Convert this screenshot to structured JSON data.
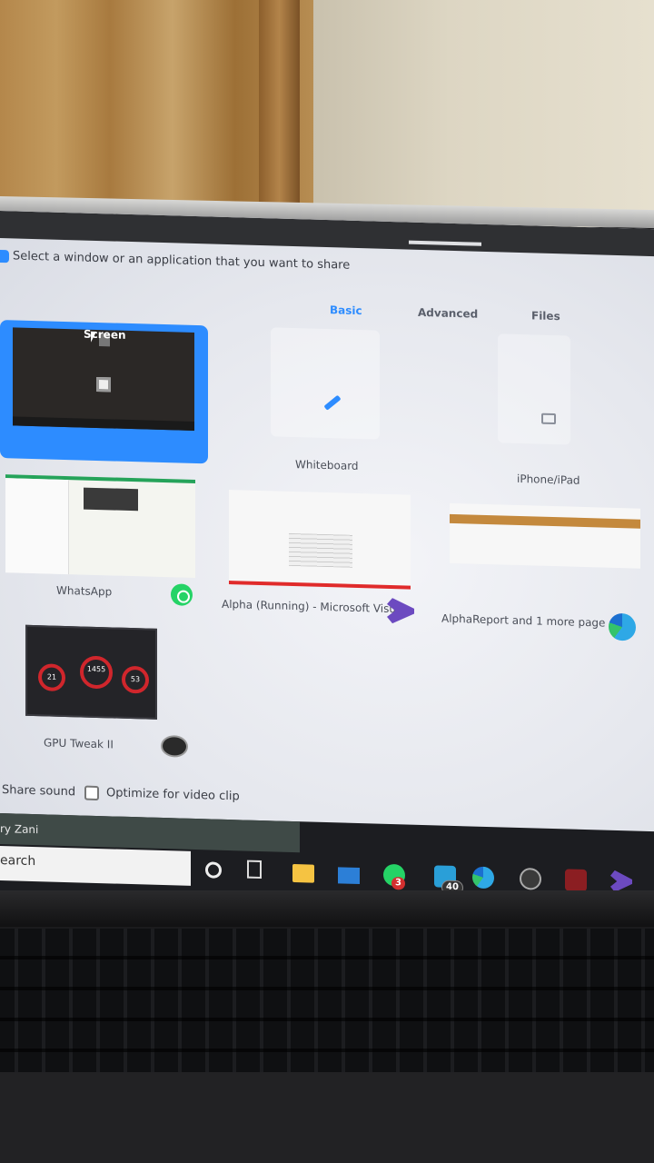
{
  "dialog": {
    "prompt": "Select a window or an application that you want to share"
  },
  "tabs": [
    {
      "label": "Basic",
      "active": true
    },
    {
      "label": "Advanced",
      "active": false
    },
    {
      "label": "Files",
      "active": false
    }
  ],
  "share_options": {
    "screen": "Screen",
    "whiteboard": "Whiteboard",
    "iphone": "iPhone/iPad"
  },
  "windows": [
    {
      "label": "WhatsApp",
      "icon": "whatsapp-icon"
    },
    {
      "label": "Alpha (Running) - Microsoft Visu...",
      "icon": "visual-studio-icon"
    },
    {
      "label": "AlphaReport and 1 more page - ...",
      "icon": "edge-icon"
    },
    {
      "label": "GPU Tweak II",
      "icon": "gpu-tweak-icon"
    }
  ],
  "gpu_thumb": {
    "values": [
      "21",
      "1455",
      "53"
    ]
  },
  "footer": {
    "share_sound": "Share sound",
    "optimize": "Optimize for video clip"
  },
  "taskbar": {
    "user": "ry Zani",
    "search": "earch",
    "whatsapp_badge": "3",
    "thunderbird_badge": "40"
  },
  "colors": {
    "accent": "#2d8cff",
    "whatsapp": "#25d366",
    "vs_purple": "#6c4ac0"
  }
}
